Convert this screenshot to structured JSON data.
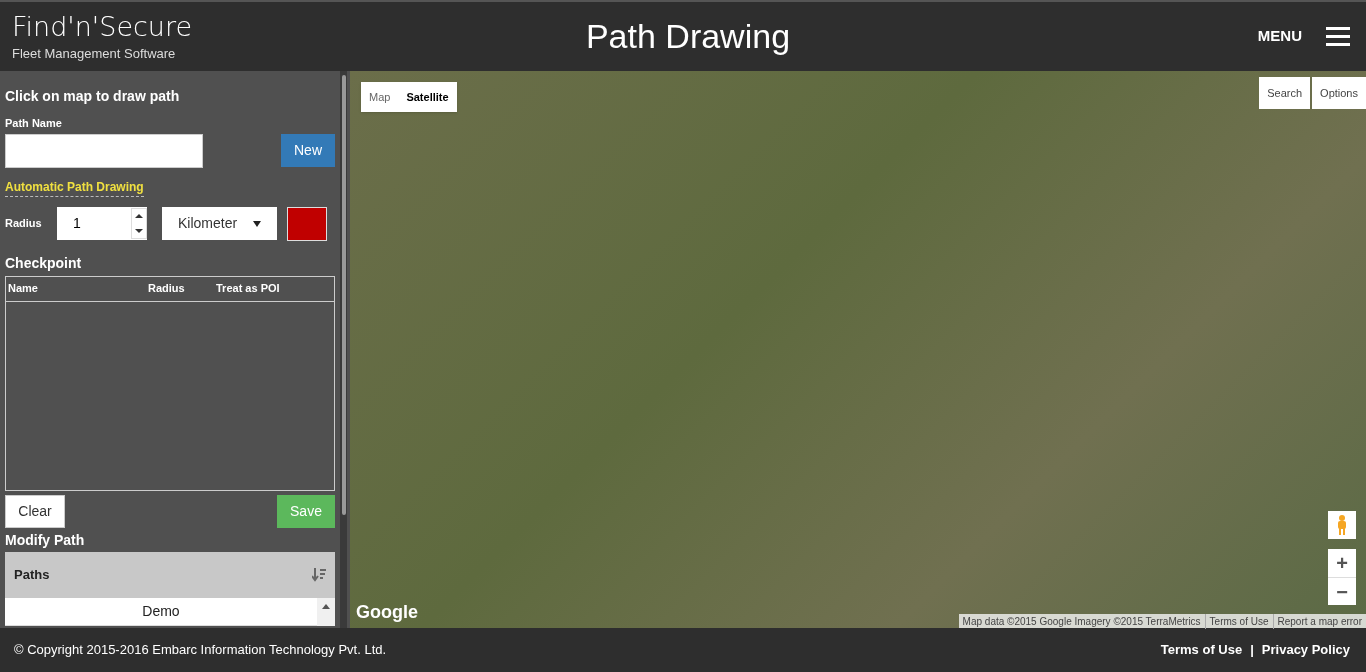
{
  "header": {
    "logo_title": "Find'n'Secure",
    "logo_subtitle": "Fleet Management Software",
    "title": "Path Drawing",
    "menu_label": "MENU"
  },
  "sidebar": {
    "heading": "Click on map to draw path",
    "path_name_label": "Path Name",
    "new_button": "New",
    "auto_link": "Automatic Path Drawing",
    "radius_label": "Radius",
    "radius_value": "1",
    "unit": "Kilometer",
    "color": "#c00000",
    "checkpoint_heading": "Checkpoint",
    "checkpoint_columns": [
      "Name",
      "Radius",
      "Treat as POI"
    ],
    "clear_button": "Clear",
    "save_button": "Save",
    "modify_heading": "Modify Path",
    "paths_header": "Paths",
    "paths": [
      "Demo"
    ]
  },
  "map": {
    "type_tabs": [
      {
        "label": "Map",
        "selected": false
      },
      {
        "label": "Satellite",
        "selected": true
      }
    ],
    "search_button": "Search",
    "options_button": "Options",
    "zoom_in": "+",
    "zoom_out": "−",
    "logo": "Google",
    "attribution": "Map data ©2015 Google Imagery ©2015 TerraMetrics",
    "terms": "Terms of Use",
    "report": "Report a map error"
  },
  "footer": {
    "copyright": "© Copyright 2015-2016 Embarc Information Technology Pvt. Ltd.",
    "links": [
      "Terms of Use",
      "Privacy Policy"
    ],
    "separator": "|"
  }
}
